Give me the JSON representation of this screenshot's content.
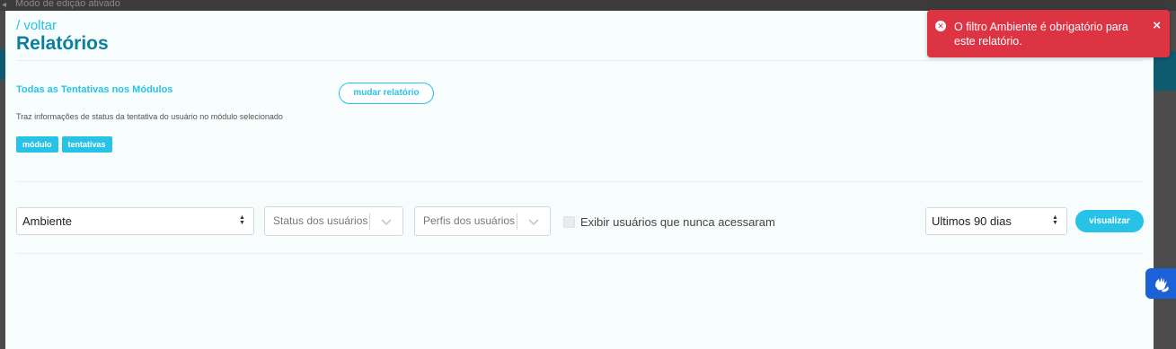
{
  "topbar": {
    "mode_text": "Modo de edição ativado"
  },
  "header": {
    "back_link": "/ voltar",
    "title": "Relatórios"
  },
  "report": {
    "name": "Todas as Tentativas nos Módulos",
    "change_label": "mudar relatório",
    "description": "Traz informações de status da tentativa do usuário no módulo selecionado",
    "tags": [
      "módulo",
      "tentativas"
    ]
  },
  "filters": {
    "ambiente": "Ambiente",
    "status_placeholder": "Status dos usuários",
    "perfis_placeholder": "Perfis dos usuários",
    "checkbox_label": "Exibir usuários que nunca acessaram",
    "checkbox_checked": false,
    "period": "Ultimos 90 dias",
    "view_label": "visualizar"
  },
  "toast": {
    "message": "O filtro Ambiente é obrigatório para este relatório.",
    "close": "×",
    "color": "#dd3444"
  },
  "colors": {
    "accent": "#27c3e6",
    "title": "#0b7f9c",
    "a11y": "#1c62d6"
  }
}
